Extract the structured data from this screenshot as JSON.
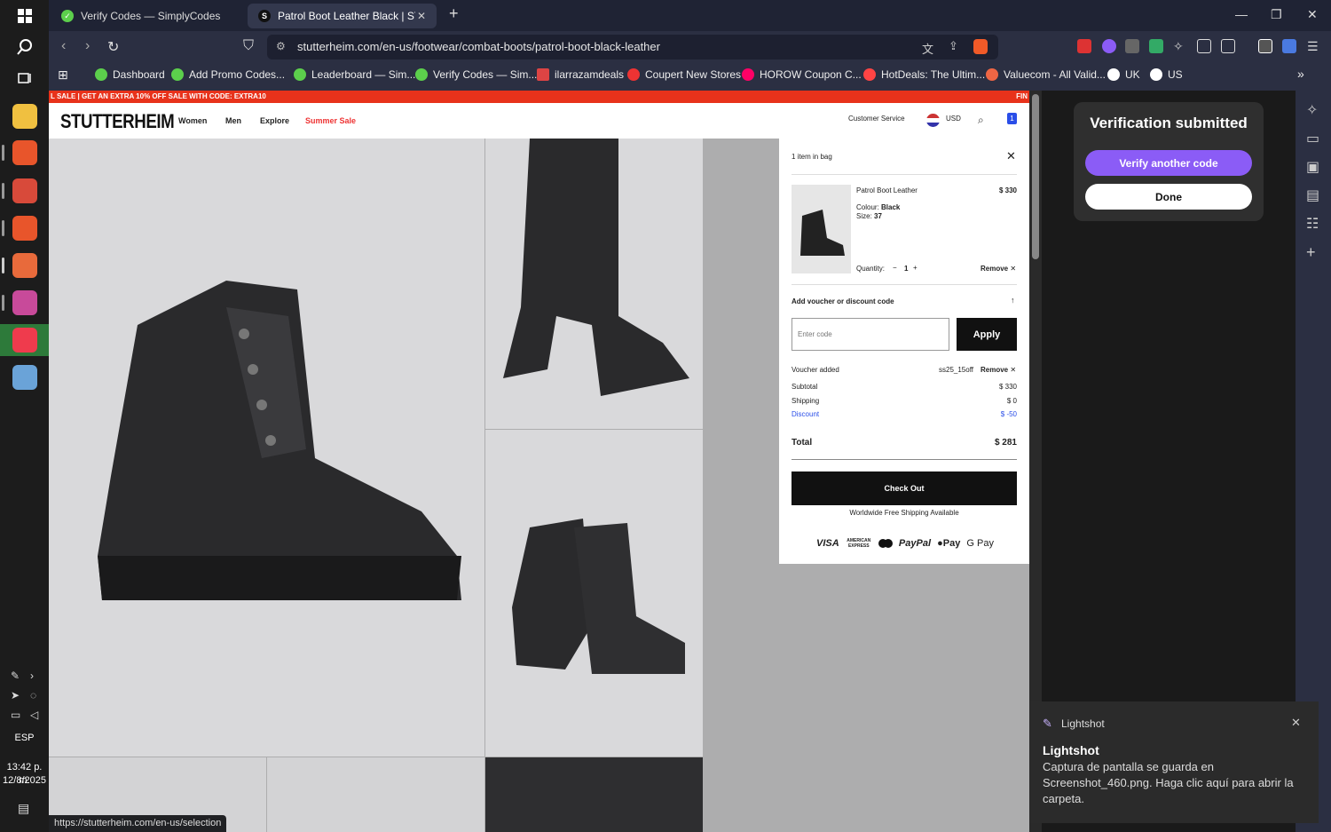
{
  "taskbar": {
    "lang": "ESP",
    "time": "13:42 p. m.",
    "date": "12/8/2025"
  },
  "tabs": [
    {
      "title": "Verify Codes — SimplyCodes"
    },
    {
      "title": "Patrol Boot Leather Black | STUT"
    }
  ],
  "address": {
    "url": "stutterheim.com/en-us/footwear/combat-boots/patrol-boot-black-leather"
  },
  "bookmarks": [
    "Dashboard",
    "Add Promo Codes...",
    "Leaderboard — Sim...",
    "Verify Codes — Sim...",
    "ilarrazamdeals",
    "Coupert New Stores",
    "HOROW Coupon C...",
    "HotDeals: The Ultim...",
    "Valuecom - All Valid...",
    "UK",
    "US"
  ],
  "site": {
    "promo": "L SALE | GET AN EXTRA 10% OFF SALE WITH CODE: EXTRA10",
    "promo_end": "FIN",
    "logo": "STUTTERHEIM",
    "nav": [
      "Women",
      "Men",
      "Explore",
      "Summer Sale"
    ],
    "customer_service": "Customer Service",
    "currency": "USD",
    "bag_count": "1"
  },
  "cart": {
    "header": "1 item in bag",
    "item": {
      "name": "Patrol Boot Leather",
      "price": "$ 330",
      "colour_label": "Colour:",
      "colour": "Black",
      "size_label": "Size:",
      "size": "37",
      "qty_label": "Quantity:",
      "qty": "1",
      "remove": "Remove"
    },
    "voucher": {
      "title": "Add voucher or discount code",
      "placeholder": "Enter code",
      "apply": "Apply",
      "added_label": "Voucher added",
      "code": "ss25_15off",
      "remove": "Remove"
    },
    "subtotal_label": "Subtotal",
    "subtotal": "$ 330",
    "shipping_label": "Shipping",
    "shipping": "$ 0",
    "discount_label": "Discount",
    "discount": "$ -50",
    "total_label": "Total",
    "total": "$ 281",
    "checkout": "Check Out",
    "shipping_note": "Worldwide Free Shipping Available",
    "payments": [
      "VISA",
      "AMERICAN EXPRESS",
      "PayPal",
      "Pay",
      "G Pay"
    ]
  },
  "verify": {
    "title": "Verification submitted",
    "another": "Verify another code",
    "done": "Done"
  },
  "toast": {
    "app": "Lightshot",
    "title": "Lightshot",
    "body": "Captura de pantalla se guarda en Screenshot_460.png. Haga clic aquí para abrir la carpeta."
  },
  "status_url": "https://stutterheim.com/en-us/selection"
}
